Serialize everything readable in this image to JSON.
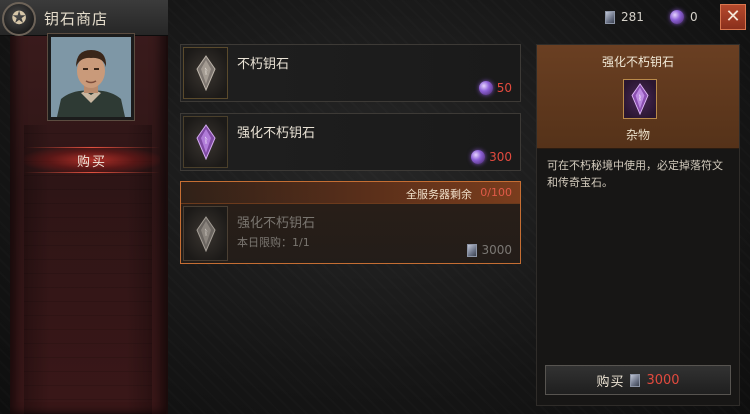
{
  "header": {
    "title": "钥石商店"
  },
  "nav": {
    "buy_tab": "购买"
  },
  "currency": {
    "crystal": "281",
    "orb": "0"
  },
  "items": [
    {
      "name": "不朽钥石",
      "price": "50"
    },
    {
      "name": "强化不朽钥石",
      "price": "300"
    },
    {
      "name": "强化不朽钥石",
      "limit_label": "全服务器剩余",
      "limit_count": "0/100",
      "daily_limit": "本日限购：1/1",
      "price": "3000"
    }
  ],
  "detail": {
    "title": "强化不朽钥石",
    "category": "杂物",
    "description": "可在不朽秘境中使用，必定掉落符文和传奇宝石。",
    "buy_label": "购买",
    "price": "3000"
  },
  "icons": {
    "emblem": "star-emblem-icon",
    "close": "close-icon",
    "crystal": "crystal-currency-icon",
    "orb": "orb-currency-icon",
    "keystone": "keystone-icon"
  },
  "colors": {
    "accent_red": "#e24a3e",
    "close_button": "#b5492c",
    "selected_border": "#c56e33",
    "header_brown": "#6a3f22",
    "gem_purple": "#8e62d8"
  }
}
